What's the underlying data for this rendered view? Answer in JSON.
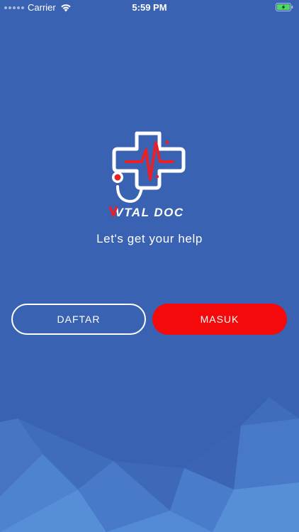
{
  "status_bar": {
    "carrier": "Carrier",
    "time": "5:59 PM",
    "wifi_icon": "wifi-icon",
    "battery_icon": "battery-charging-icon"
  },
  "logo": {
    "brand_text": "VTAL DOC",
    "icon": "medical-cross-stethoscope-heartbeat-icon"
  },
  "tagline": "Let's get your help",
  "buttons": {
    "daftar_label": "DAFTAR",
    "masuk_label": "MASUK"
  },
  "colors": {
    "background": "#3a62b2",
    "primary_button": "#f40a0a",
    "battery_fill": "#4cd964",
    "logo_accent": "#e8202a"
  }
}
